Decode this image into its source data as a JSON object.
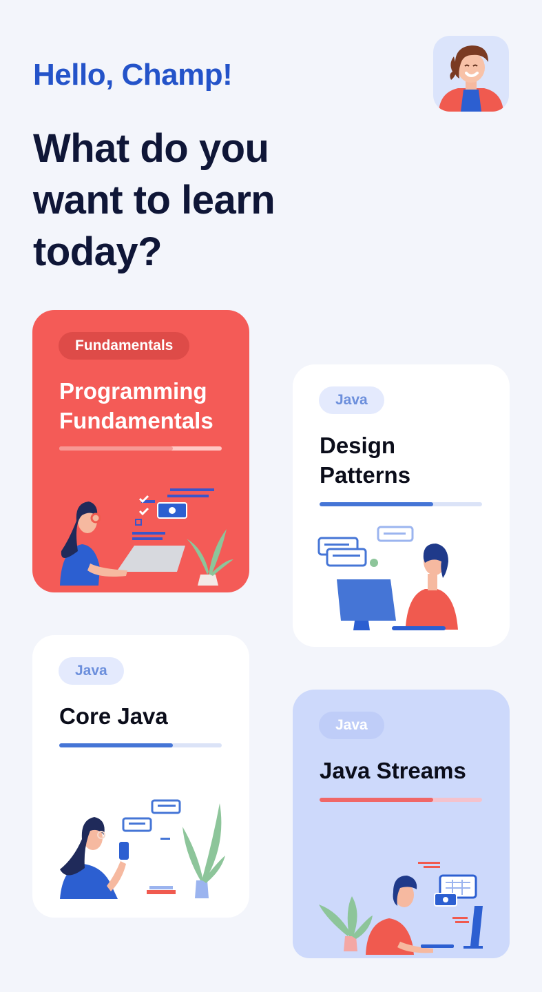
{
  "header": {
    "greeting": "Hello, Champ!",
    "headline": "What do you want to learn today?",
    "avatar": "profile-avatar"
  },
  "colors": {
    "background": "#f3f5fb",
    "accent_blue": "#2453c9",
    "headline": "#0f1637",
    "card_red": "#f45b57",
    "card_white": "#ffffff",
    "card_lavender": "#cdd9fb"
  },
  "courses": [
    {
      "category": "Fundamentals",
      "title": "Programming Fundamentals",
      "progress": 0.7,
      "illustration": "woman-laptop-illustration"
    },
    {
      "category": "Java",
      "title": "Design Patterns",
      "progress": 0.7,
      "illustration": "man-computer-illustration"
    },
    {
      "category": "Java",
      "title": "Core Java",
      "progress": 0.7,
      "illustration": "woman-phone-illustration"
    },
    {
      "category": "Java",
      "title": "Java Streams",
      "progress": 0.7,
      "illustration": "man-monitor-illustration"
    }
  ]
}
